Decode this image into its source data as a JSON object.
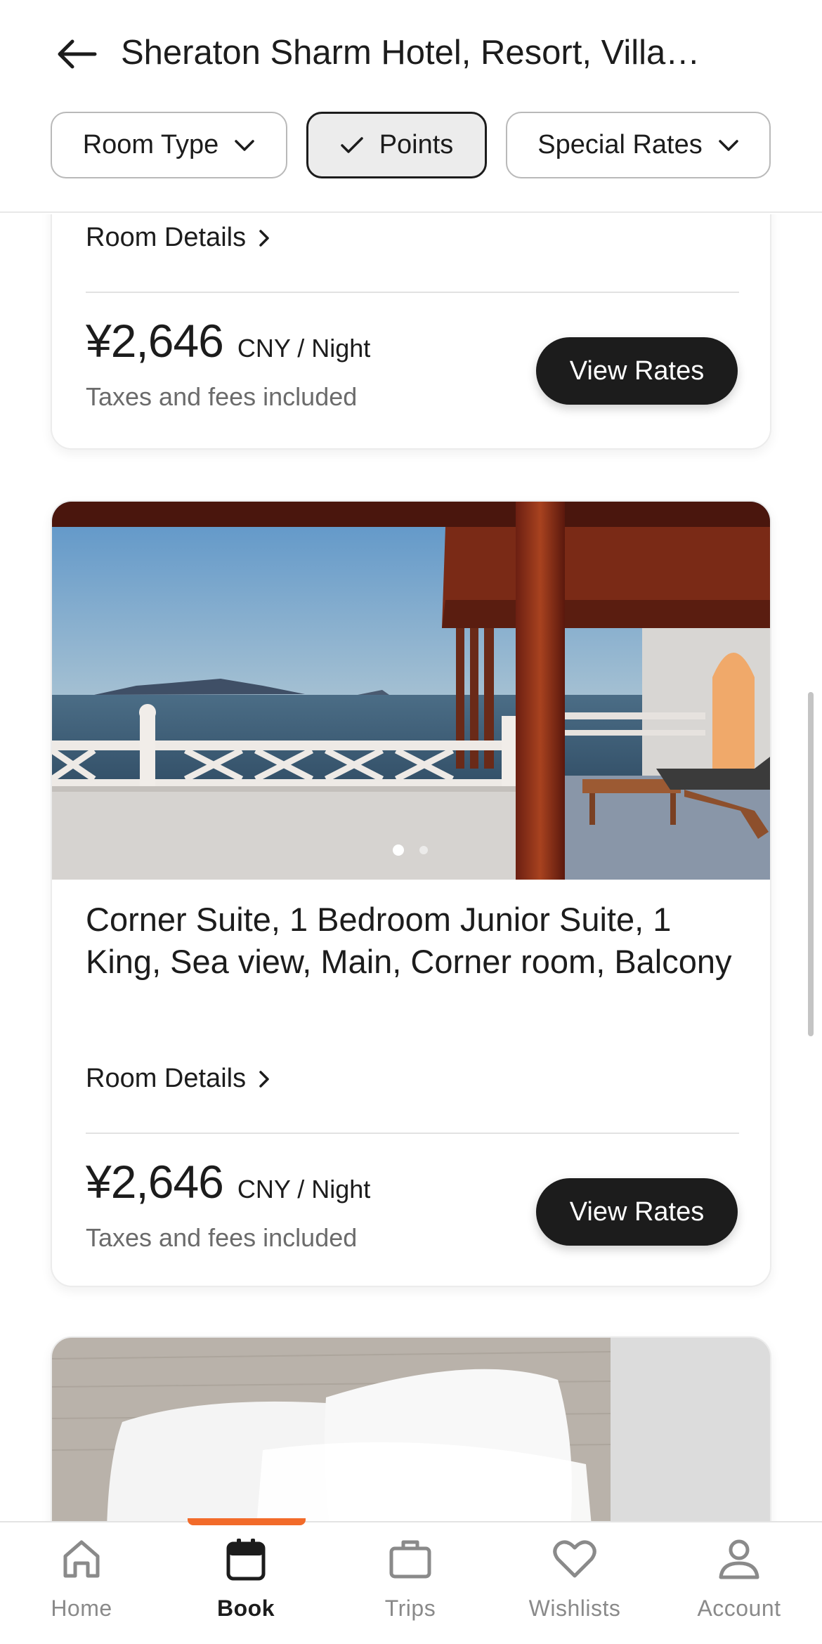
{
  "header": {
    "back_icon": "arrow-left-icon",
    "title": "Sheraton Sharm Hotel, Resort, Villa…",
    "filters": {
      "room_type": "Room Type",
      "points": "Points",
      "special_rates": "Special Rates"
    }
  },
  "rooms": [
    {
      "details_label": "Room Details",
      "price": "¥2,646",
      "price_unit": "CNY / Night",
      "taxes_note": "Taxes and fees included",
      "button_label": "View Rates"
    },
    {
      "name": "Corner Suite, 1 Bedroom Junior Suite, 1 King, Sea view, Main, Corner room, Balcony",
      "details_label": "Room Details",
      "price": "¥2,646",
      "price_unit": "CNY / Night",
      "taxes_note": "Taxes and fees included",
      "button_label": "View Rates",
      "photo_count": 2,
      "photo_active_index": 0
    }
  ],
  "bottom_nav": {
    "active_index": 1,
    "items": [
      {
        "label": "Home",
        "icon": "home-icon"
      },
      {
        "label": "Book",
        "icon": "calendar-icon"
      },
      {
        "label": "Trips",
        "icon": "suitcase-icon"
      },
      {
        "label": "Wishlists",
        "icon": "heart-icon"
      },
      {
        "label": "Account",
        "icon": "person-icon"
      }
    ]
  },
  "colors": {
    "accent": "#f26b2a",
    "primary_button": "#1c1c1c",
    "muted_text": "#6b6b6b"
  }
}
